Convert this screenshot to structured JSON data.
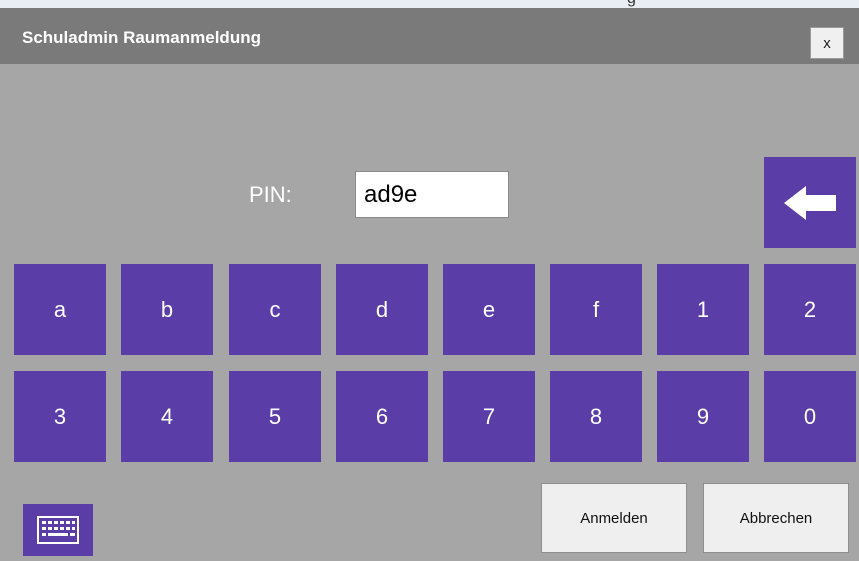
{
  "window": {
    "title": "Schuladmin Raumanmeldung",
    "top_fragment": "g",
    "close_label": "x"
  },
  "pin": {
    "label": "PIN:",
    "value": "ad9e"
  },
  "keypad": {
    "row1": [
      "a",
      "b",
      "c",
      "d",
      "e",
      "f",
      "1",
      "2"
    ],
    "row2": [
      "3",
      "4",
      "5",
      "6",
      "7",
      "8",
      "9",
      "0"
    ]
  },
  "buttons": {
    "login_label": "Anmelden",
    "cancel_label": "Abbrechen"
  },
  "icons": {
    "backspace": "arrow-left-icon",
    "keyboard": "keyboard-icon"
  },
  "colors": {
    "key_bg": "#5b3da8",
    "titlebar_bg": "#7a7a7a",
    "body_bg": "#a6a6a6"
  }
}
